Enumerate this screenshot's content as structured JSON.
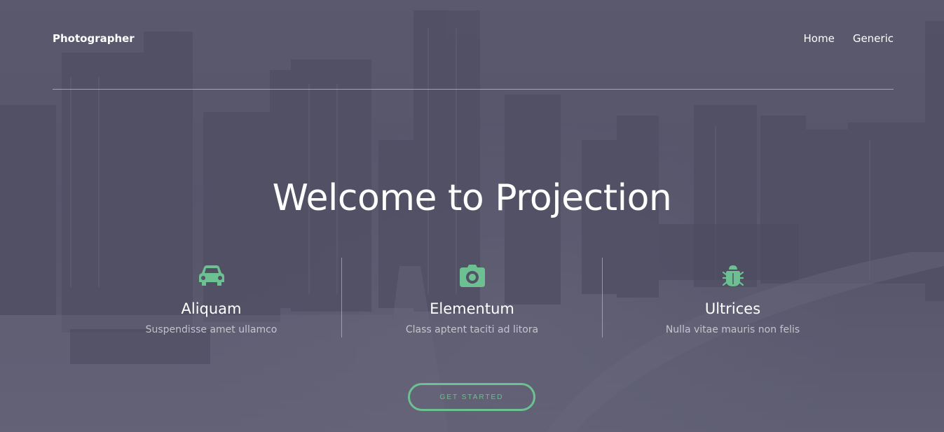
{
  "brand": "Photographer",
  "nav": {
    "items": [
      "Home",
      "Generic"
    ]
  },
  "hero": {
    "title": "Welcome to Projection",
    "cta_label": "Get Started"
  },
  "features": [
    {
      "icon": "car-icon",
      "title": "Aliquam",
      "text": "Suspendisse amet ullamco"
    },
    {
      "icon": "camera-icon",
      "title": "Elementum",
      "text": "Class aptent taciti ad litora"
    },
    {
      "icon": "bug-icon",
      "title": "Ultrices",
      "text": "Nulla vitae mauris non felis"
    }
  ],
  "colors": {
    "accent": "#6cc091",
    "overlay": "#58566c",
    "text": "#ffffff"
  }
}
